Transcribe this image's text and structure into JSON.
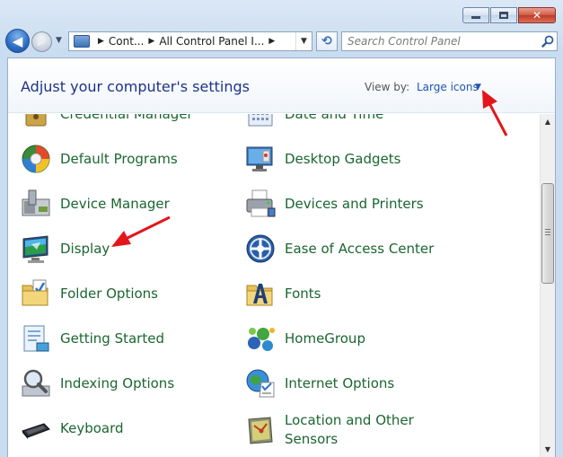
{
  "window": {
    "minimize_glyph": "",
    "maximize_glyph": "",
    "close_glyph": "✕"
  },
  "nav": {
    "back_glyph": "◀",
    "forward_glyph": "▶",
    "recent_glyph": "▼",
    "refresh_glyph": "⟲"
  },
  "address": {
    "crumbs": [
      "Cont...",
      "All Control Panel I..."
    ]
  },
  "search": {
    "placeholder": "Search Control Panel"
  },
  "header": {
    "title": "Adjust your computer's settings",
    "view_by_label": "View by:",
    "view_mode": "Large icons",
    "view_caret": "▼"
  },
  "items": {
    "credential_manager": "Credential Manager",
    "date_and_time": "Date and Time",
    "default_programs": "Default Programs",
    "desktop_gadgets": "Desktop Gadgets",
    "device_manager": "Device Manager",
    "devices_and_printers": "Devices and Printers",
    "display": "Display",
    "ease_of_access": "Ease of Access Center",
    "folder_options": "Folder Options",
    "fonts": "Fonts",
    "getting_started": "Getting Started",
    "homegroup": "HomeGroup",
    "indexing_options": "Indexing Options",
    "internet_options": "Internet Options",
    "keyboard": "Keyboard",
    "location_sensors_line1": "Location and Other",
    "location_sensors_line2": "Sensors"
  },
  "scrollbar": {
    "up_glyph": "▲",
    "down_glyph": "▼"
  },
  "colors": {
    "item_link": "#1a6630",
    "header_title": "#1e3287",
    "view_mode_link": "#1f55b5",
    "annotation_arrow": "#e3161b"
  }
}
